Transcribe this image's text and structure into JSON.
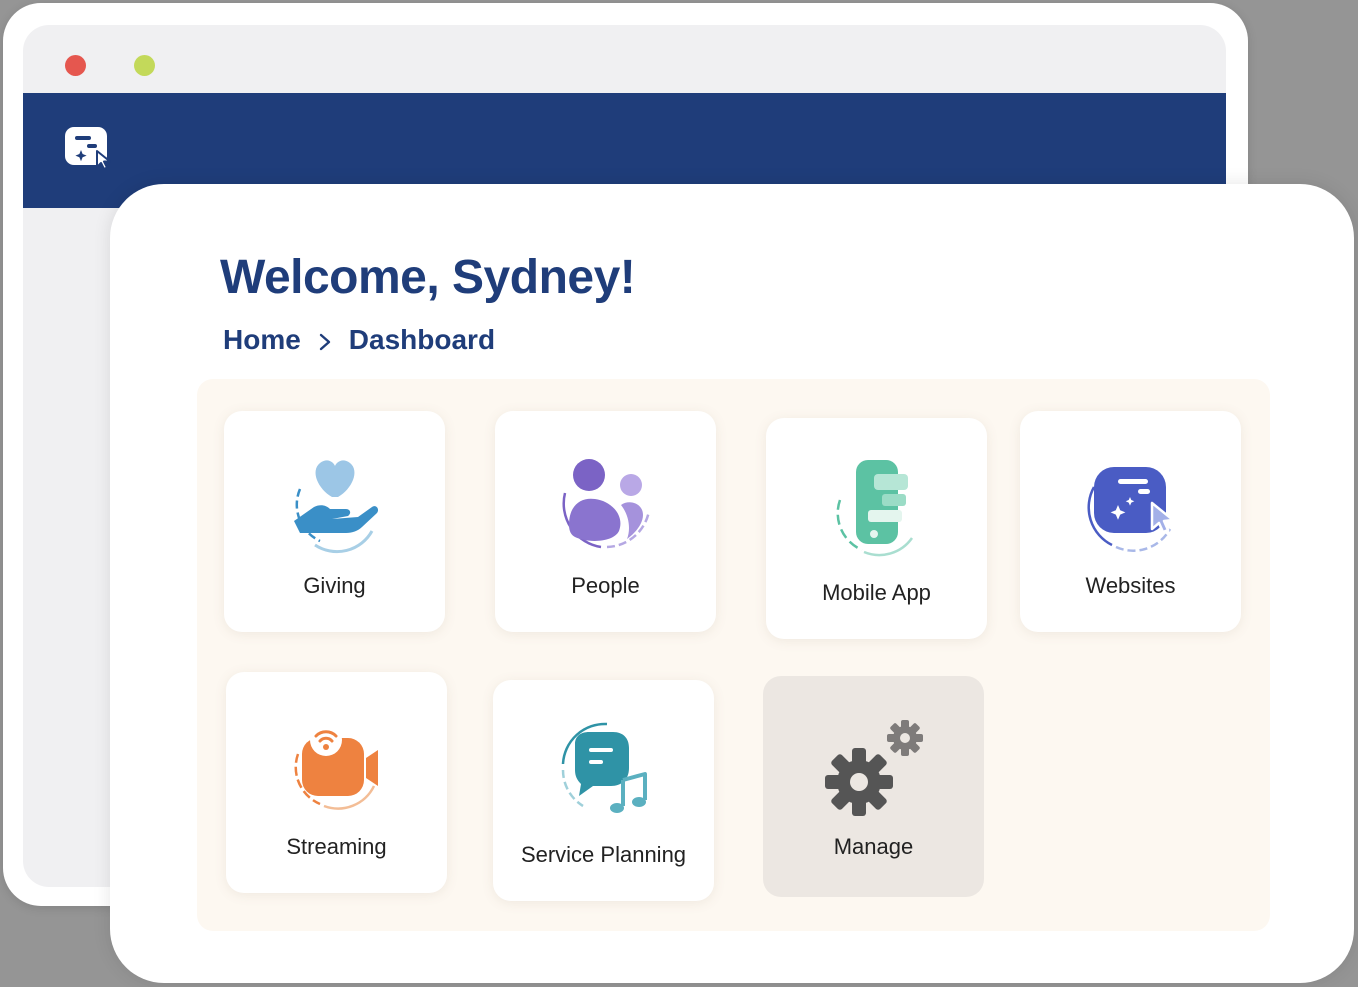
{
  "window": {
    "controls": [
      "close",
      "minimize"
    ],
    "logo_icon": "sparkle-cursor-logo-icon",
    "header_color": "#1f3d7a"
  },
  "page": {
    "welcome_title": "Welcome, Sydney!",
    "breadcrumb": {
      "home": "Home",
      "separator_icon": "chevron-right-icon",
      "current": "Dashboard"
    }
  },
  "tiles": [
    {
      "label": "Giving",
      "icon": "heart-hand-icon",
      "color": "#3a8fc7"
    },
    {
      "label": "People",
      "icon": "people-icon",
      "color": "#7b63c5"
    },
    {
      "label": "Mobile App",
      "icon": "mobile-app-icon",
      "color": "#5cc2a3"
    },
    {
      "label": "Websites",
      "icon": "website-cursor-icon",
      "color": "#4a5cc4"
    },
    {
      "label": "Streaming",
      "icon": "video-camera-icon",
      "color": "#ee8240"
    },
    {
      "label": "Service Planning",
      "icon": "chat-music-icon",
      "color": "#2f93a6"
    },
    {
      "label": "Manage",
      "icon": "gears-icon",
      "color": "#5a5a5a"
    }
  ]
}
